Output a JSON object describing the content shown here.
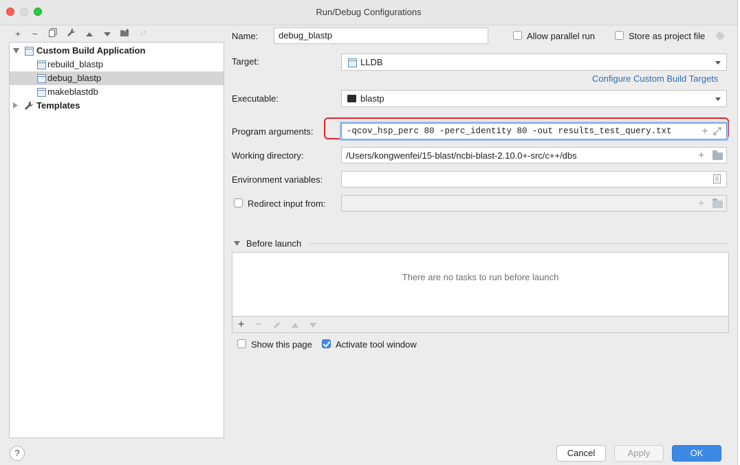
{
  "window": {
    "title": "Run/Debug Configurations"
  },
  "toolbar": {
    "icons": [
      "add-icon",
      "remove-icon",
      "copy-icon",
      "wrench-icon",
      "move-up-icon",
      "move-down-icon",
      "new-folder-icon",
      "sort-icon"
    ]
  },
  "tree": {
    "group_label": "Custom Build Application",
    "items": [
      {
        "label": "rebuild_blastp"
      },
      {
        "label": "debug_blastp"
      },
      {
        "label": "makeblastdb"
      }
    ],
    "templates_label": "Templates"
  },
  "form": {
    "name_label": "Name:",
    "name_value": "debug_blastp",
    "allow_parallel_label": "Allow parallel run",
    "store_project_label": "Store as project file",
    "target_label": "Target:",
    "target_value": "LLDB",
    "configure_link": "Configure Custom Build Targets",
    "executable_label": "Executable:",
    "executable_value": "blastp",
    "program_args_label": "Program arguments:",
    "program_args_value": "-qcov_hsp_perc 80 -perc_identity 80 -out results_test_query.txt",
    "working_dir_label": "Working directory:",
    "working_dir_value": "/Users/kongwenfei/15-blast/ncbi-blast-2.10.0+-src/c++/dbs",
    "env_vars_label": "Environment variables:",
    "env_vars_value": "",
    "redirect_label": "Redirect input from:"
  },
  "before_launch": {
    "header": "Before launch",
    "empty_text": "There are no tasks to run before launch"
  },
  "options": {
    "show_page_label": "Show this page",
    "activate_tool_label": "Activate tool window"
  },
  "buttons": {
    "help": "?",
    "cancel": "Cancel",
    "apply": "Apply",
    "ok": "OK"
  },
  "colors": {
    "accent": "#3d8ae5",
    "highlight_border": "#e0242b",
    "link": "#2f6db3"
  }
}
